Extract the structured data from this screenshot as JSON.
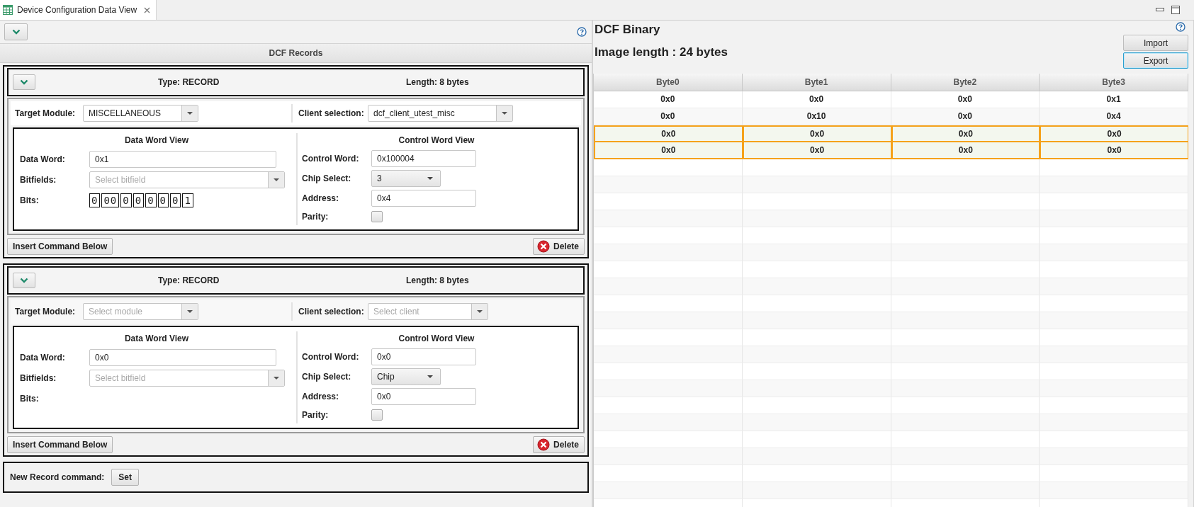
{
  "tab": {
    "title": "Device Configuration Data View"
  },
  "records_panel": {
    "section_title": "DCF Records",
    "records": [
      {
        "type": "Type: RECORD",
        "length": "Length: 8 bytes",
        "target_label": "Target Module:",
        "target": {
          "value": "MISCELLANEOUS"
        },
        "client_label": "Client selection:",
        "client": {
          "value": "dcf_client_utest_misc"
        },
        "data_view_title": "Data Word View",
        "data_word_label": "Data Word:",
        "data_word": "0x1",
        "bitfields_label": "Bitfields:",
        "bitfields": {
          "placeholder": "Select bitfield"
        },
        "bits_label": "Bits:",
        "bits": [
          "0",
          "00",
          "0",
          "0",
          "0",
          "0",
          "0",
          "1"
        ],
        "control_view_title": "Control Word View",
        "control_word_label": "Control Word:",
        "control_word": "0x100004",
        "chip_select_label": "Chip Select:",
        "chip_select": "3",
        "address_label": "Address:",
        "address": "0x4",
        "parity_label": "Parity:",
        "parity_checked": false,
        "insert_button": "Insert Command Below",
        "delete_button": "Delete"
      },
      {
        "type": "Type: RECORD",
        "length": "Length: 8 bytes",
        "target_label": "Target Module:",
        "target": {
          "placeholder": "Select module"
        },
        "client_label": "Client selection:",
        "client": {
          "placeholder": "Select client"
        },
        "data_view_title": "Data Word View",
        "data_word_label": "Data Word:",
        "data_word": "0x0",
        "bitfields_label": "Bitfields:",
        "bitfields": {
          "placeholder": "Select bitfield"
        },
        "bits_label": "Bits:",
        "control_view_title": "Control Word View",
        "control_word_label": "Control Word:",
        "control_word": "0x0",
        "chip_select_label": "Chip Select:",
        "chip_select": "Chip",
        "address_label": "Address:",
        "address": "0x0",
        "parity_label": "Parity:",
        "parity_checked": false,
        "insert_button": "Insert Command Below",
        "delete_button": "Delete"
      }
    ],
    "new_record": {
      "label": "New Record command:",
      "button": "Set"
    }
  },
  "binary_panel": {
    "title": "DCF Binary",
    "image_length": "Image length : 24 bytes",
    "buttons": [
      {
        "label": "Import",
        "focused": false
      },
      {
        "label": "Export",
        "focused": true
      }
    ],
    "table": {
      "columns": [
        "Byte0",
        "Byte1",
        "Byte2",
        "Byte3"
      ],
      "rows": [
        {
          "cells": [
            "0x0",
            "0x0",
            "0x0",
            "0x1"
          ],
          "selected": false
        },
        {
          "cells": [
            "0x0",
            "0x10",
            "0x0",
            "0x4"
          ],
          "selected": false
        },
        {
          "cells": [
            "0x0",
            "0x0",
            "0x0",
            "0x0"
          ],
          "selected": true
        },
        {
          "cells": [
            "0x0",
            "0x0",
            "0x0",
            "0x0"
          ],
          "selected": true
        }
      ]
    }
  }
}
